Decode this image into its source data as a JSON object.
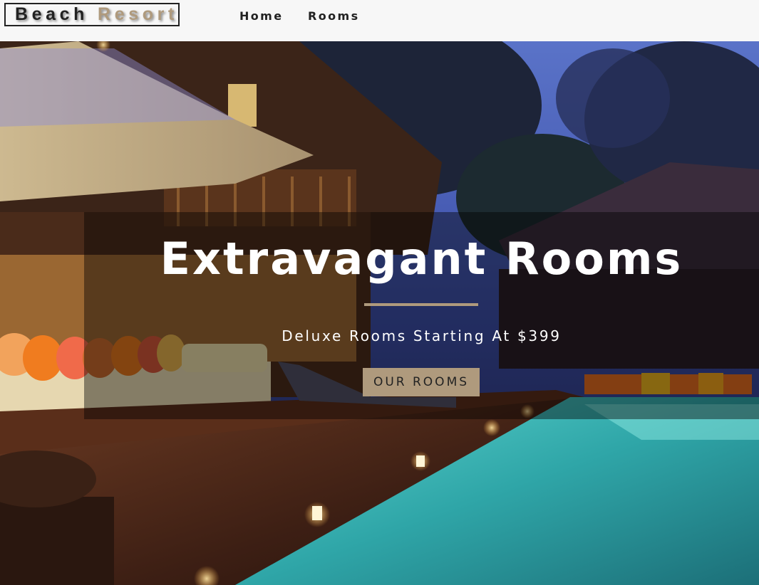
{
  "navbar": {
    "logo_word1": "Beach",
    "logo_word2": "Resort",
    "links": [
      {
        "label": "Home"
      },
      {
        "label": "Rooms"
      }
    ]
  },
  "hero": {
    "title": "Extravagant Rooms",
    "subtitle": "Deluxe Rooms Starting At $399",
    "button_label": "OUR ROOMS"
  },
  "colors": {
    "accent": "#af9a7d",
    "text_dark": "#222222",
    "navbar_bg": "#f7f7f7",
    "banner_overlay": "rgba(0,0,0,0.42)"
  }
}
